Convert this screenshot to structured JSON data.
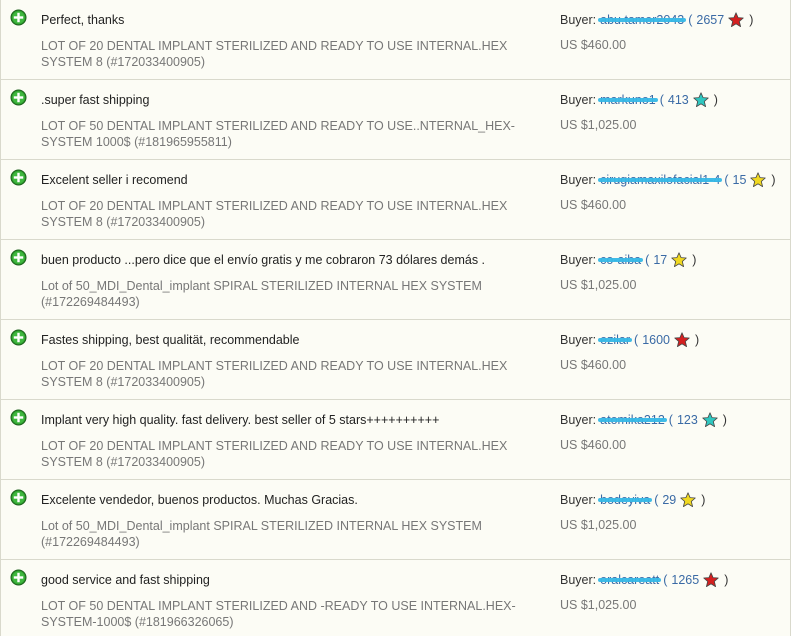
{
  "labels": {
    "buyer_prefix": "Buyer:"
  },
  "feedback": [
    {
      "comment": "Perfect, thanks",
      "item": "LOT OF 20 DENTAL IMPLANT STERILIZED AND READY TO USE INTERNAL.HEX SYSTEM 8 (#172033400905)",
      "buyer": "abu.tamer2043",
      "score": "2657",
      "star_color": "#d42020",
      "price": "US $460.00"
    },
    {
      "comment": ".super fast shipping",
      "item": "LOT OF 50 DENTAL IMPLANT STERILIZED AND READY TO USE..NTERNAL_HEX-SYSTEM 1000$ (#181965955811)",
      "buyer": "markuno1",
      "score": "413",
      "star_color": "#2fc7c0",
      "price": "US $1,025.00"
    },
    {
      "comment": "Excelent seller i recomend",
      "item": "LOT OF 20 DENTAL IMPLANT STERILIZED AND READY TO USE INTERNAL.HEX SYSTEM 8 (#172033400905)",
      "buyer": "cirugiamaxilofacial1-4",
      "score": "15",
      "star_color": "#f0d820",
      "price": "US $460.00"
    },
    {
      "comment": "buen producto ...pero dice que el envío gratis y me cobraron 73 dólares demás .",
      "item": "Lot of 50_MDI_Dental_implant SPIRAL STERILIZED INTERNAL HEX SYSTEM (#172269484493)",
      "buyer": "co-aiba",
      "score": "17",
      "star_color": "#f0d820",
      "price": "US $1,025.00"
    },
    {
      "comment": "Fastes shipping, best qualität, recommendable",
      "item": "LOT OF 20 DENTAL IMPLANT STERILIZED AND READY TO USE INTERNAL.HEX SYSTEM 8 (#172033400905)",
      "buyer": "ezilar",
      "score": "1600",
      "star_color": "#d42020",
      "price": "US $460.00"
    },
    {
      "comment": "Implant very high quality. fast delivery. best seller of 5 stars++++++++++",
      "item": "LOT OF 20 DENTAL IMPLANT STERILIZED AND READY TO USE INTERNAL.HEX SYSTEM 8 (#172033400905)",
      "buyer": "atomika212",
      "score": "123",
      "star_color": "#2fc7c0",
      "price": "US $460.00"
    },
    {
      "comment": "Excelente vendedor, buenos productos. Muchas Gracias.",
      "item": "Lot of 50_MDI_Dental_implant SPIRAL STERILIZED INTERNAL HEX SYSTEM (#172269484493)",
      "buyer": "bodeyiva",
      "score": "29",
      "star_color": "#f0d820",
      "price": "US $1,025.00"
    },
    {
      "comment": "good service and fast shipping",
      "item": "LOT OF 50 DENTAL IMPLANT STERILIZED AND -READY TO USE INTERNAL.HEX-SYSTEM-1000$ (#181966326065)",
      "buyer": "oralcareatt",
      "score": "1265",
      "star_color": "#d42020",
      "price": "US $1,025.00"
    }
  ]
}
